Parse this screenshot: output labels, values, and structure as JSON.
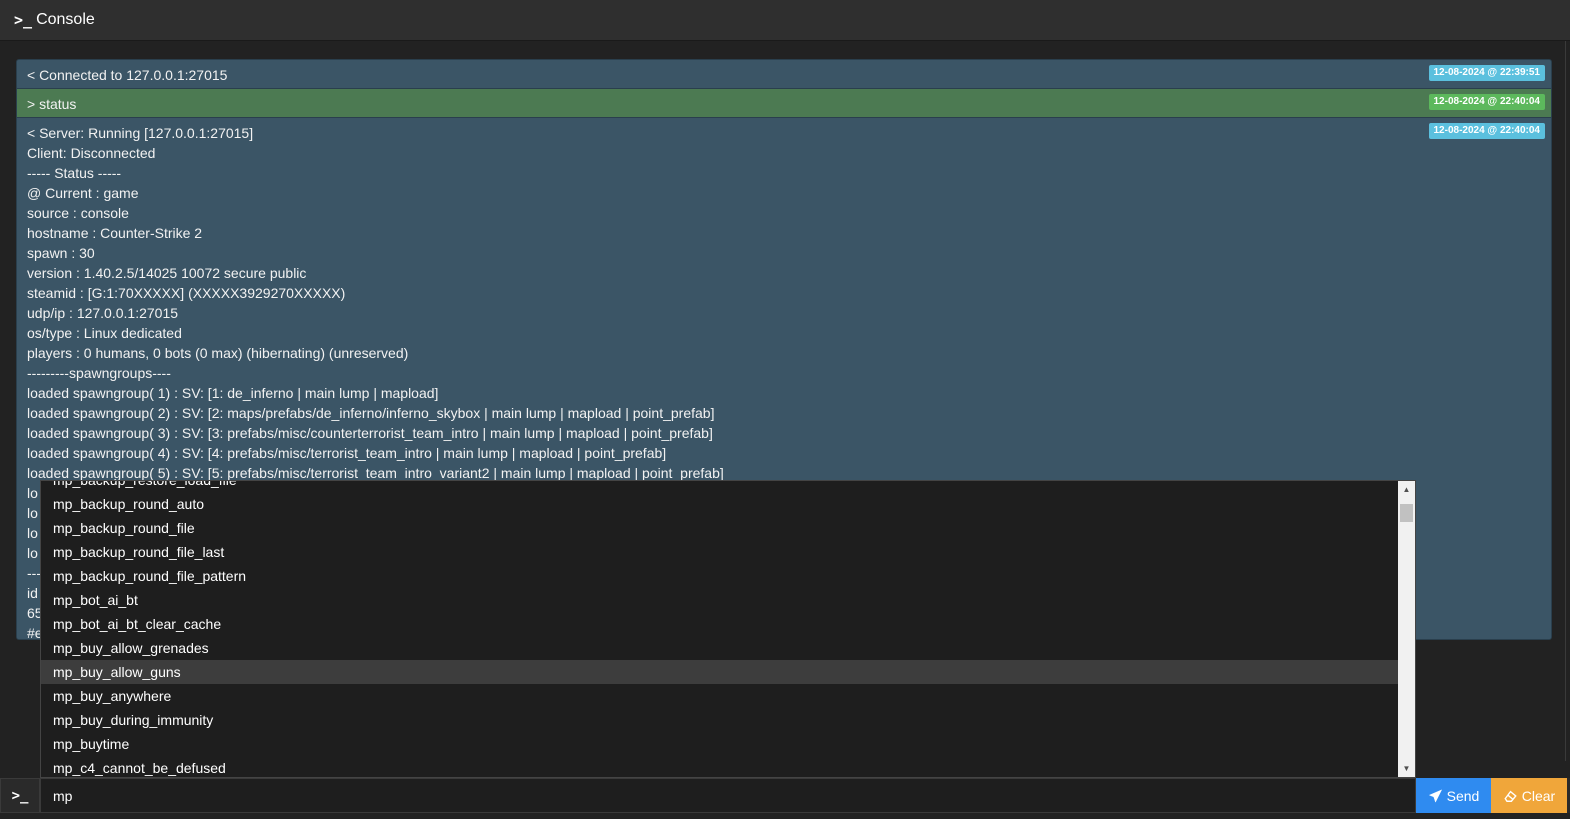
{
  "header": {
    "prompt_glyph": ">_",
    "title": "Console"
  },
  "log": [
    {
      "kind": "out",
      "timestamp": "12-08-2024 @ 22:39:51",
      "lines": [
        "< Connected to 127.0.0.1:27015"
      ]
    },
    {
      "kind": "cmd",
      "timestamp": "12-08-2024 @ 22:40:04",
      "lines": [
        "> status"
      ]
    },
    {
      "kind": "out",
      "timestamp": "12-08-2024 @ 22:40:04",
      "lines": [
        "< Server: Running [127.0.0.1:27015]",
        "Client: Disconnected",
        "----- Status -----",
        "@ Current : game",
        "source : console",
        "hostname : Counter-Strike 2",
        "spawn : 30",
        "version : 1.40.2.5/14025 10072 secure public",
        "steamid : [G:1:70XXXXX] (XXXXX3929270XXXXX)",
        "udp/ip : 127.0.0.1:27015",
        "os/type : Linux dedicated",
        "players : 0 humans, 0 bots (0 max) (hibernating) (unreserved)",
        "---------spawngroups----",
        "loaded spawngroup( 1) : SV: [1: de_inferno | main lump | mapload]",
        "loaded spawngroup( 2) : SV: [2: maps/prefabs/de_inferno/inferno_skybox | main lump | mapload | point_prefab]",
        "loaded spawngroup( 3) : SV: [3: prefabs/misc/counterterrorist_team_intro | main lump | mapload | point_prefab]",
        "loaded spawngroup( 4) : SV: [4: prefabs/misc/terrorist_team_intro | main lump | mapload | point_prefab]",
        "loaded spawngroup( 5) : SV: [5: prefabs/misc/terrorist_team_intro_variant2 | main lump | mapload | point_prefab]",
        "lo",
        "lo",
        "lo",
        "lo",
        "---",
        "id",
        "65",
        "#e"
      ]
    }
  ],
  "autocomplete": {
    "items": [
      "mp_backup_restore_load_file",
      "mp_backup_round_auto",
      "mp_backup_round_file",
      "mp_backup_round_file_last",
      "mp_backup_round_file_pattern",
      "mp_bot_ai_bt",
      "mp_bot_ai_bt_clear_cache",
      "mp_buy_allow_grenades",
      "mp_buy_allow_guns",
      "mp_buy_anywhere",
      "mp_buy_during_immunity",
      "mp_buytime",
      "mp_c4_cannot_be_defused"
    ],
    "active_index": 8
  },
  "input": {
    "prompt_glyph": ">_",
    "value": "mp"
  },
  "buttons": {
    "send": "Send",
    "clear": "Clear"
  },
  "colors": {
    "output_bg": "#3b5566",
    "command_bg": "#4c7a52",
    "timestamp_blue": "#5bc0de",
    "timestamp_green": "#5cb85c",
    "send_bg": "#2f8bf0",
    "clear_bg": "#f0a63a"
  }
}
